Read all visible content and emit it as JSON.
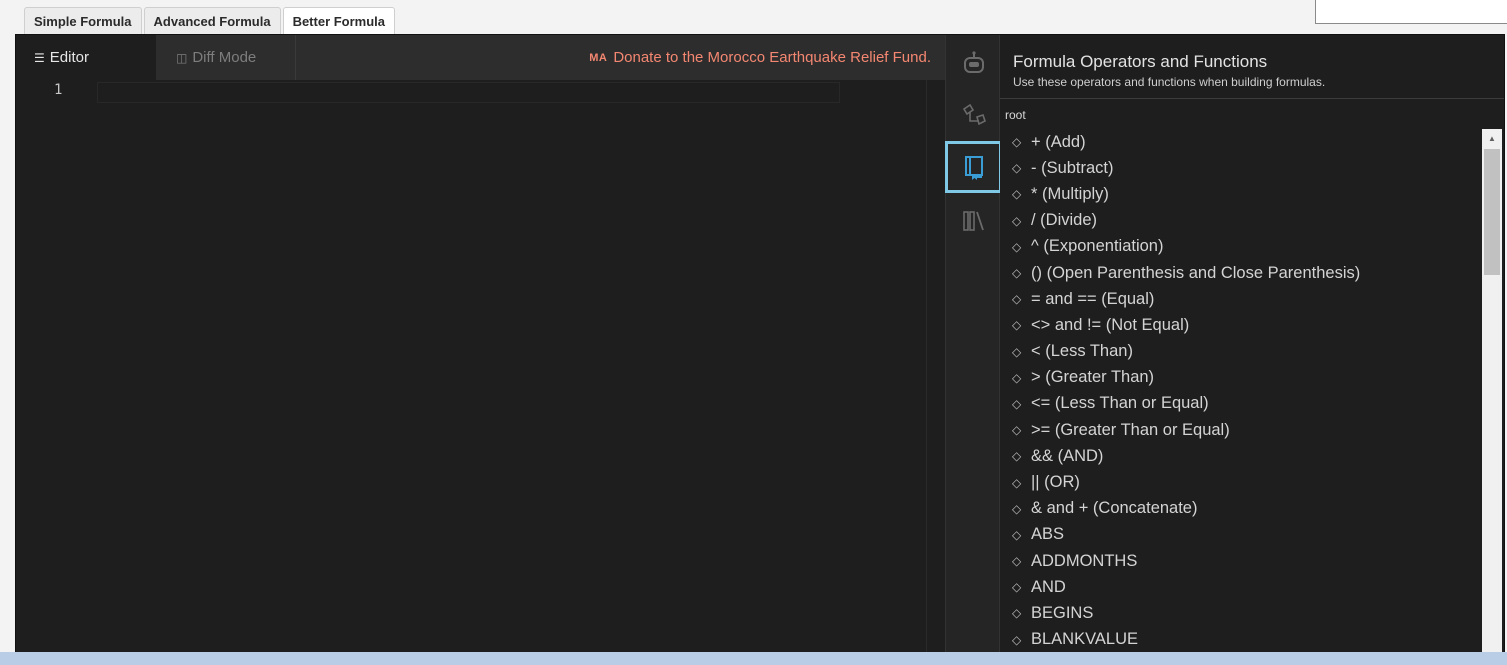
{
  "formula_tabs": [
    "Simple Formula",
    "Advanced Formula",
    "Better Formula"
  ],
  "editor_tabs": {
    "editor": "Editor",
    "diff": "Diff Mode"
  },
  "donate": {
    "code": "MA",
    "text": "Donate to the Morocco Earthquake Relief Fund."
  },
  "editor": {
    "line_number": "1"
  },
  "panel": {
    "title": "Formula Operators and Functions",
    "subtitle": "Use these operators and functions when building formulas.",
    "root": "root",
    "items": [
      "+ (Add)",
      "- (Subtract)",
      "* (Multiply)",
      "/ (Divide)",
      "^ (Exponentiation)",
      "() (Open Parenthesis and Close Parenthesis)",
      "= and == (Equal)",
      "<> and != (Not Equal)",
      "< (Less Than)",
      "> (Greater Than)",
      "<= (Less Than or Equal)",
      ">= (Greater Than or Equal)",
      "&& (AND)",
      "|| (OR)",
      "& and + (Concatenate)",
      "ABS",
      "ADDMONTHS",
      "AND",
      "BEGINS",
      "BLANKVALUE"
    ]
  },
  "activity_icons": [
    "robot-icon",
    "schema-icon",
    "book-icon",
    "library-icon"
  ],
  "colors": {
    "accent": "#3a9dd6",
    "selected_border": "#7fc8e6",
    "donate": "#f48771"
  }
}
